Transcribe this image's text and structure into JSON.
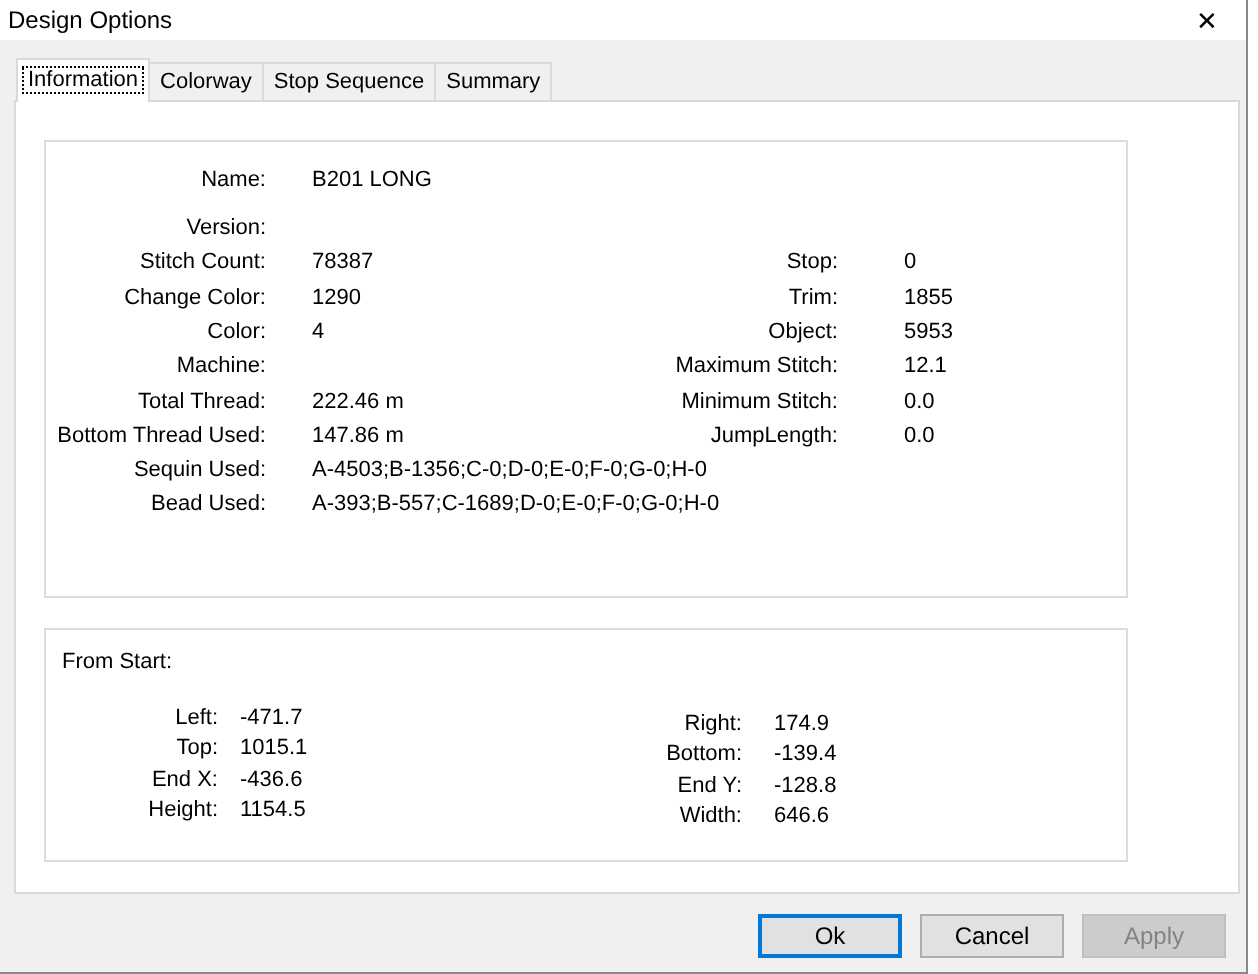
{
  "window": {
    "title": "Design Options",
    "close": "✕"
  },
  "tabs": [
    {
      "label": "Information",
      "selected": true
    },
    {
      "label": "Colorway",
      "selected": false
    },
    {
      "label": "Stop Sequence",
      "selected": false
    },
    {
      "label": "Summary",
      "selected": false
    }
  ],
  "info": {
    "rows": [
      {
        "left": {
          "label": "Name:",
          "value": "B201 LONG"
        }
      },
      {
        "left": {
          "label": "Version:"
        }
      },
      {
        "left": {
          "label": "Stitch Count:",
          "value": "78387"
        },
        "right": {
          "label": "Stop:",
          "value": "0"
        }
      },
      {
        "left": {
          "label": "Change Color:",
          "value": "1290"
        },
        "right": {
          "label": "Trim:",
          "value": "1855"
        }
      },
      {
        "left": {
          "label": "Color:",
          "value": "4"
        },
        "right": {
          "label": "Object:",
          "value": "5953"
        }
      },
      {
        "left": {
          "label": "Machine:"
        },
        "right": {
          "label": "Maximum Stitch:",
          "value": "12.1"
        }
      },
      {
        "left": {
          "label": "Total Thread:",
          "value": "222.46 m"
        },
        "right": {
          "label": "Minimum Stitch:",
          "value": "0.0"
        }
      },
      {
        "left": {
          "label": "Bottom Thread Used:",
          "value": "147.86 m"
        },
        "right": {
          "label": "JumpLength:",
          "value": "0.0"
        }
      },
      {
        "left": {
          "label": "Sequin Used:",
          "value": "A-4503;B-1356;C-0;D-0;E-0;F-0;G-0;H-0"
        }
      },
      {
        "left": {
          "label": "Bead Used:",
          "value": "A-393;B-557;C-1689;D-0;E-0;F-0;G-0;H-0"
        }
      }
    ]
  },
  "from_start": {
    "title": "From Start:",
    "left": [
      {
        "label": "Left:",
        "value": "-471.7"
      },
      {
        "label": "Top:",
        "value": "1015.1"
      },
      {
        "label": "End X:",
        "value": "-436.6"
      },
      {
        "label": "Height:",
        "value": "1154.5"
      }
    ],
    "right": [
      {
        "label": "Right:",
        "value": "174.9"
      },
      {
        "label": "Bottom:",
        "value": "-139.4"
      },
      {
        "label": "End Y:",
        "value": "-128.8"
      },
      {
        "label": "Width:",
        "value": "646.6"
      }
    ]
  },
  "buttons": [
    {
      "label": "Ok",
      "default": true,
      "disabled": false
    },
    {
      "label": "Cancel",
      "default": false,
      "disabled": false
    },
    {
      "label": "Apply",
      "default": false,
      "disabled": true
    }
  ]
}
